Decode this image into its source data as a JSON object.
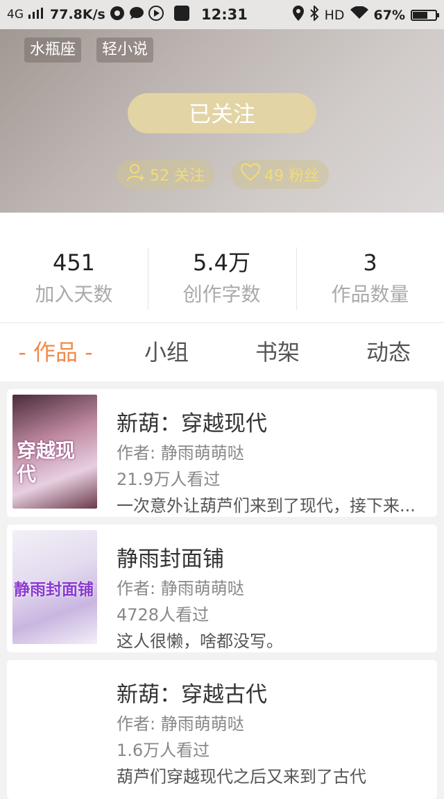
{
  "status_bar": {
    "network": "4G",
    "speed": "77.8K/s",
    "time": "12:31",
    "hd": "HD",
    "battery": "67%",
    "battery_level": 0.67
  },
  "profile": {
    "tags": [
      "水瓶座",
      "轻小说"
    ],
    "follow_button": "已关注",
    "following": "52 关注",
    "fans": "49 粉丝"
  },
  "stats": [
    {
      "value": "451",
      "label": "加入天数"
    },
    {
      "value": "5.4万",
      "label": "创作字数"
    },
    {
      "value": "3",
      "label": "作品数量"
    }
  ],
  "tabs": [
    "- 作品 -",
    "小组",
    "书架",
    "动态"
  ],
  "works": [
    {
      "title": "新葫：穿越现代",
      "author": "作者: 静雨萌萌哒",
      "views": "21.9万人看过",
      "desc": "一次意外让葫芦们来到了现代，接下来...",
      "cover_text": "穿越现代"
    },
    {
      "title": "静雨封面铺",
      "author": "作者: 静雨萌萌哒",
      "views": "4728人看过",
      "desc": "这人很懒，啥都没写。",
      "cover_text": "静雨封面铺"
    },
    {
      "title": "新葫：穿越古代",
      "author": "作者: 静雨萌萌哒",
      "views": "1.6万人看过",
      "desc": "葫芦们穿越现代之后又来到了古代"
    }
  ],
  "colors": {
    "accent": "#f08a4b",
    "follow_btn": "#e2d4a4",
    "pill_text": "#f2dc74"
  }
}
